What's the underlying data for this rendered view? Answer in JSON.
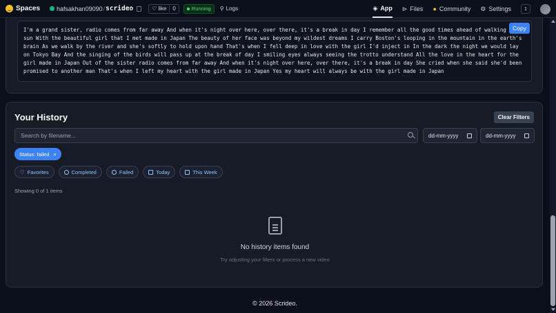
{
  "topbar": {
    "spaces_label": "Spaces",
    "owner": "hafsakhan09090",
    "repo": "scrideo",
    "like_label": "like",
    "like_count": "0",
    "status": "Running",
    "logs_label": "Logs",
    "nav": [
      {
        "label": "App",
        "active": true
      },
      {
        "label": "Files"
      },
      {
        "label": "Community"
      },
      {
        "label": "Settings"
      }
    ],
    "notif_count": "1"
  },
  "transcript": {
    "text": "I'm a grand sister, radio comes from far away And when it's night over here, over there, it's a break in day I remember all the good times ahead of walking in sun With the beautiful girl that I met made in Japan The beauty of her face was beyond my wildest dreams I carry Boston's looping in the mountain in the earth's brain As we walk by the river and she's softly to hold upon hand That's when I fell deep in love with the girl I'd inject in In the dark the night we would lay on Tokyo Bay And the singing of the birds will pass up at the break of day I smiling eyes always seeing the trotto understand All the love in the heart for the girl made in Japan Out of the sister radio comes from far away And when it's night over here, over there, it's a break in day She cried when she said she'd been promised to another man That's when I left my heart with the girl made in Japan Yes my heart will always be with the girl made in Japan",
    "copy_label": "Copy"
  },
  "history": {
    "title": "Your History",
    "clear_label": "Clear Filters",
    "search_placeholder": "Search by filename...",
    "date_from": "dd-mm-yyyy",
    "date_to": "dd-mm-yyyy",
    "active_filter": "Status: failed",
    "filters": [
      "Favorites",
      "Completed",
      "Failed",
      "Today",
      "This Week"
    ],
    "showing": "Showing 0 of 1 items",
    "empty_title": "No history items found",
    "empty_sub": "Try adjusting your filters or process a new video"
  },
  "footer": "© 2026 Scrideo."
}
